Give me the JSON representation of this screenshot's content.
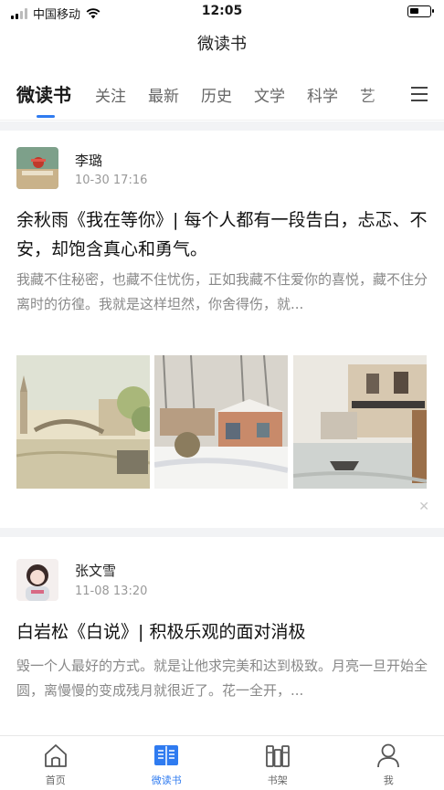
{
  "status_bar": {
    "carrier": "中国移动",
    "time": "12:05"
  },
  "header": {
    "title": "微读书"
  },
  "tabs": [
    {
      "label": "微读书",
      "active": true
    },
    {
      "label": "关注"
    },
    {
      "label": "最新"
    },
    {
      "label": "历史"
    },
    {
      "label": "文学"
    },
    {
      "label": "科学"
    },
    {
      "label": "艺"
    }
  ],
  "articles": [
    {
      "author": "李璐",
      "datetime": "10-30 17:16",
      "title": "余秋雨《我在等你》| 每个人都有一段告白，忐忑、不安，却饱含真心和勇气。",
      "summary": "我藏不住秘密，也藏不住忧伤，正如我藏不住爱你的喜悦，藏不住分离时的彷徨。我就是这样坦然，你舍得伤，就..."
    },
    {
      "author": "张文雪",
      "datetime": "11-08 13:20",
      "title": "白岩松《白说》| 积极乐观的面对消极",
      "summary": "毁一个人最好的方式。就是让他求完美和达到极致。月亮一旦开始全圆，离慢慢的变成残月就很近了。花一全开，..."
    }
  ],
  "bottom_nav": [
    {
      "label": "首页",
      "icon": "home-icon"
    },
    {
      "label": "微读书",
      "icon": "book-icon",
      "active": true
    },
    {
      "label": "书架",
      "icon": "bookshelf-icon"
    },
    {
      "label": "我",
      "icon": "user-icon"
    }
  ],
  "colors": {
    "accent": "#2f7bf0",
    "muted_text": "#888888",
    "divider": "#f2f3f5"
  }
}
